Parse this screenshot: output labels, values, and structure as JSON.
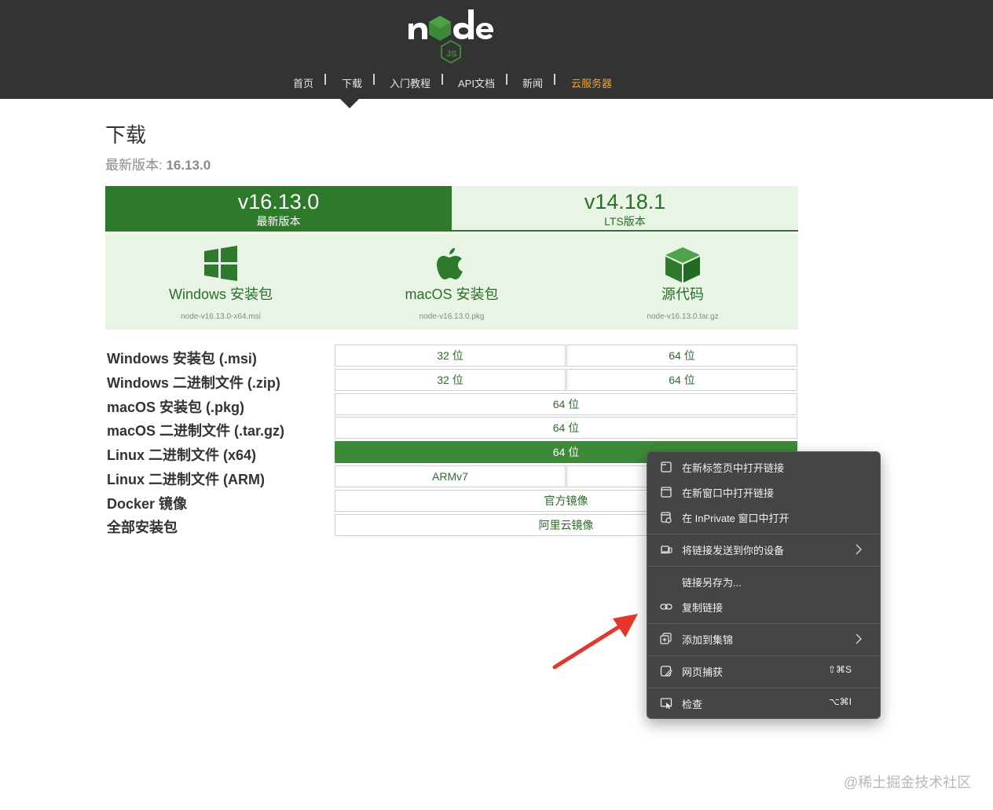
{
  "header": {
    "logo_text": "node",
    "nav": [
      {
        "label": "首页"
      },
      {
        "label": "下载"
      },
      {
        "label": "入门教程"
      },
      {
        "label": "API文档"
      },
      {
        "label": "新闻"
      },
      {
        "label": "云服务器"
      }
    ]
  },
  "page": {
    "title": "下载",
    "latest_prefix": "最新版本: ",
    "latest_version": "16.13.0"
  },
  "tabs": [
    {
      "version": "v16.13.0",
      "label": "最新版本",
      "active": true
    },
    {
      "version": "v14.18.1",
      "label": "LTS版本",
      "active": false
    }
  ],
  "cards": [
    {
      "icon": "windows-icon",
      "label": "Windows 安装包",
      "file": "node-v16.13.0-x64.msi"
    },
    {
      "icon": "apple-icon",
      "label": "macOS 安装包",
      "file": "node-v16.13.0.pkg"
    },
    {
      "icon": "source-box-icon",
      "label": "源代码",
      "file": "node-v16.13.0.tar.gz"
    }
  ],
  "downloads": [
    {
      "label": "Windows 安装包 (.msi)",
      "cells": [
        "32 位",
        "64 位"
      ]
    },
    {
      "label": "Windows 二进制文件 (.zip)",
      "cells": [
        "32 位",
        "64 位"
      ]
    },
    {
      "label": "macOS 安装包 (.pkg)",
      "cells": [
        "64 位"
      ]
    },
    {
      "label": "macOS 二进制文件 (.tar.gz)",
      "cells": [
        "64 位"
      ]
    },
    {
      "label": "Linux 二进制文件 (x64)",
      "cells": [
        "64 位"
      ]
    },
    {
      "label": "Linux 二进制文件 (ARM)",
      "cells": [
        "ARMv7",
        ""
      ]
    },
    {
      "label": "Docker 镜像",
      "cells": [
        "官方镜像"
      ]
    },
    {
      "label": "全部安装包",
      "cells": [
        "阿里云镜像"
      ]
    }
  ],
  "context_menu": {
    "items": [
      {
        "icon": "new-tab-icon",
        "label": "在新标签页中打开链接"
      },
      {
        "icon": "new-window-icon",
        "label": "在新窗口中打开链接"
      },
      {
        "icon": "inprivate-window-icon",
        "label": "在 InPrivate 窗口中打开"
      },
      {
        "icon": "send-to-device-icon",
        "label": "将链接发送到你的设备",
        "submenu": true
      },
      {
        "icon": "",
        "label": "链接另存为..."
      },
      {
        "icon": "link-icon",
        "label": "复制链接"
      },
      {
        "icon": "add-to-collection-icon",
        "label": "添加到集锦",
        "submenu": true
      },
      {
        "icon": "web-capture-icon",
        "label": "网页捕获",
        "shortcut": "⇧⌘S"
      },
      {
        "icon": "inspect-icon",
        "label": "检查",
        "shortcut": "⌥⌘I"
      }
    ]
  },
  "watermark": "@稀土掘金技术社区",
  "colors": {
    "header_bg": "#333333",
    "node_green": "#2d7a2b",
    "light_green_bg": "#e8f5e5",
    "highlight_cell": "#3c8a38",
    "cloud_link": "#f5a623",
    "menu_bg": "#454545",
    "annotation_arrow": "#e8352a"
  }
}
